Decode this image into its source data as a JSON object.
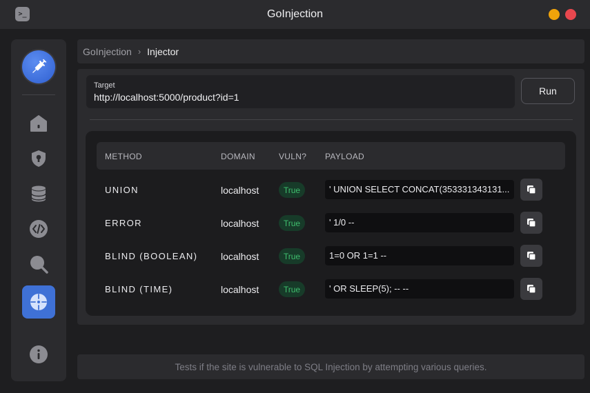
{
  "window": {
    "title": "GoInjection",
    "app_icon_glyph": ">_",
    "accent": "#3f71d6",
    "minimize_color": "#f0a30a",
    "close_color": "#e8474e"
  },
  "sidebar": {
    "logo_icon": "syringe-icon",
    "items": [
      {
        "icon": "home-icon",
        "active": false
      },
      {
        "icon": "shield-icon",
        "active": false
      },
      {
        "icon": "database-icon",
        "active": false
      },
      {
        "icon": "code-icon",
        "active": false
      },
      {
        "icon": "search-icon",
        "active": false
      },
      {
        "icon": "crosshair-icon",
        "active": true
      }
    ],
    "bottom_icon": "info-icon"
  },
  "breadcrumb": {
    "root": "GoInjection",
    "separator": "›",
    "current": "Injector"
  },
  "target": {
    "label": "Target",
    "value": "http://localhost:5000/product?id=1"
  },
  "run_button": {
    "label": "Run"
  },
  "table": {
    "headers": [
      "METHOD",
      "DOMAIN",
      "VULN?",
      "PAYLOAD"
    ],
    "rows": [
      {
        "method": "UNION",
        "domain": "localhost",
        "vuln": "True",
        "payload": "' UNION SELECT CONCAT(353331343131..."
      },
      {
        "method": "ERROR",
        "domain": "localhost",
        "vuln": "True",
        "payload": "' 1/0 --"
      },
      {
        "method": "BLIND (BOOLEAN)",
        "domain": "localhost",
        "vuln": "True",
        "payload": "1=0 OR 1=1 --"
      },
      {
        "method": "BLIND (TIME)",
        "domain": "localhost",
        "vuln": "True",
        "payload": "' OR SLEEP(5); -- --"
      }
    ]
  },
  "footer": {
    "text": "Tests if the site is vulnerable to SQL Injection by attempting various queries."
  }
}
